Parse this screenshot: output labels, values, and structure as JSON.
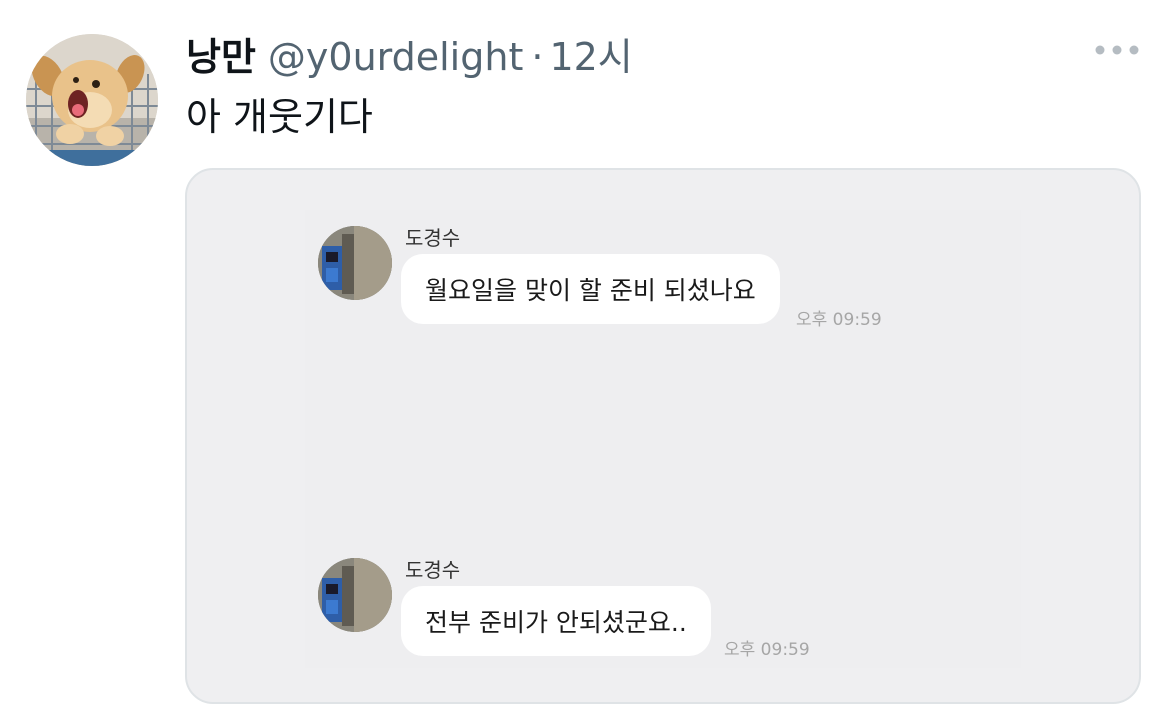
{
  "tweet": {
    "display_name": "낭만",
    "handle": "@y0urdelight",
    "separator": "·",
    "time": "12시",
    "text": "아 개웃기다",
    "avatar_icon": "puppy-avatar",
    "more_icon": "more-dots-icon"
  },
  "media": {
    "messages": [
      {
        "sender": "도경수",
        "text": "월요일을 맞이 할 준비 되셨나요",
        "timestamp": "오후 09:59"
      },
      {
        "sender": "도경수",
        "text": "전부 준비가 안되셨군요..",
        "timestamp": "오후 09:59"
      }
    ]
  },
  "colors": {
    "text_primary": "#0f1419",
    "text_secondary": "#536471",
    "media_background": "#efeff1",
    "bubble": "#ffffff",
    "timestamp": "#a6a6a6"
  }
}
